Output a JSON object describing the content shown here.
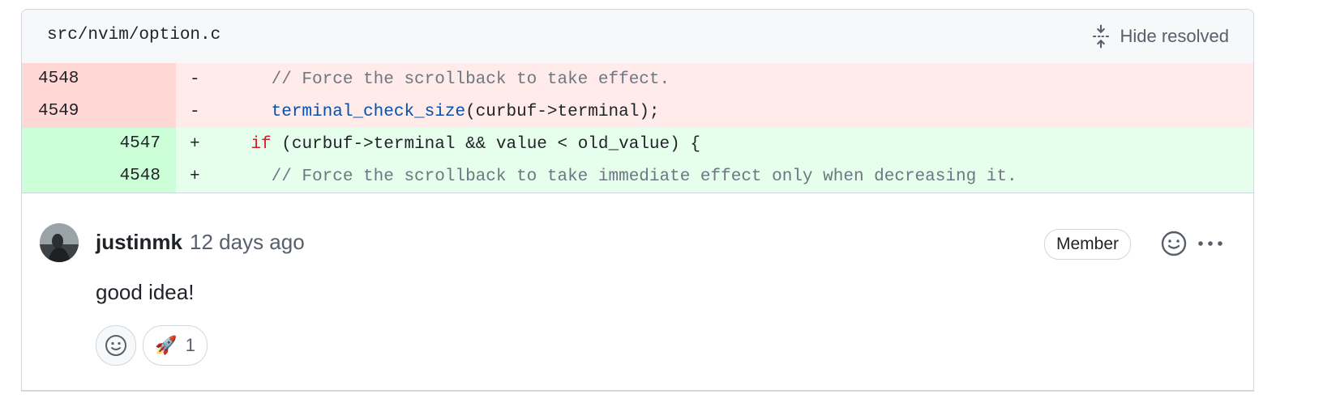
{
  "file": {
    "path": "src/nvim/option.c",
    "hide_resolved_label": "Hide resolved"
  },
  "diff": {
    "rows": [
      {
        "type": "del",
        "old": "4548",
        "new": "",
        "marker": "-",
        "code_parts": [
          {
            "t": "      ",
            "c": ""
          },
          {
            "t": "// Force the scrollback to take effect.",
            "c": "comment"
          }
        ]
      },
      {
        "type": "del",
        "old": "4549",
        "new": "",
        "marker": "-",
        "code_parts": [
          {
            "t": "      ",
            "c": ""
          },
          {
            "t": "terminal_check_size",
            "c": "func"
          },
          {
            "t": "(curbuf->terminal);",
            "c": ""
          }
        ]
      },
      {
        "type": "add",
        "old": "",
        "new": "4547",
        "marker": "+",
        "code_parts": [
          {
            "t": "    ",
            "c": ""
          },
          {
            "t": "if",
            "c": "kw"
          },
          {
            "t": " (curbuf->terminal && value < old_value) {",
            "c": ""
          }
        ]
      },
      {
        "type": "add",
        "old": "",
        "new": "4548",
        "marker": "+",
        "code_parts": [
          {
            "t": "      ",
            "c": ""
          },
          {
            "t": "// Force the scrollback to take immediate effect only when decreasing it.",
            "c": "comment"
          }
        ]
      }
    ]
  },
  "comment": {
    "author": "justinmk",
    "time": "12 days ago",
    "badge": "Member",
    "body": "good idea!",
    "reactions": [
      {
        "emoji": "🚀",
        "icon": "rocket-icon",
        "count": "1"
      }
    ]
  }
}
